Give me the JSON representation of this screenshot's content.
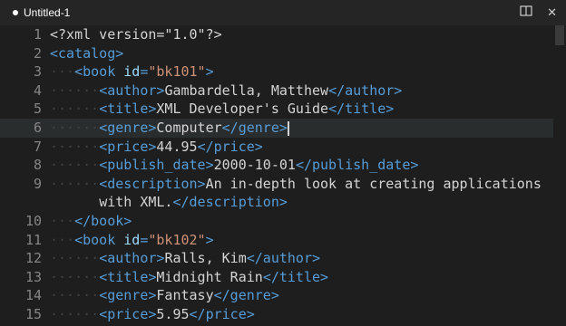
{
  "tab": {
    "title": "Untitled-1",
    "unsaved": true
  },
  "actions": {
    "split_icon": "split-editor-icon",
    "close_icon": "close-icon"
  },
  "colors": {
    "tag": "#569cd6",
    "attr": "#9cdcfe",
    "string": "#ce9178",
    "text": "#d4d4d4",
    "line_number": "#858585",
    "whitespace": "#404040"
  },
  "lines": [
    {
      "n": "1",
      "indent": "",
      "parts": [
        [
          "pi",
          "<?xml version=\"1.0\"?>"
        ]
      ]
    },
    {
      "n": "2",
      "indent": "",
      "parts": [
        [
          "tag",
          "<catalog>"
        ]
      ]
    },
    {
      "n": "3",
      "indent": "···",
      "parts": [
        [
          "tag",
          "<book "
        ],
        [
          "attr",
          "id"
        ],
        [
          "tag",
          "="
        ],
        [
          "str",
          "\"bk101\""
        ],
        [
          "tag",
          ">"
        ]
      ]
    },
    {
      "n": "4",
      "indent": "······",
      "parts": [
        [
          "tag",
          "<author>"
        ],
        [
          "txt",
          "Gambardella, Matthew"
        ],
        [
          "tag",
          "</author>"
        ]
      ]
    },
    {
      "n": "5",
      "indent": "······",
      "parts": [
        [
          "tag",
          "<title>"
        ],
        [
          "txt",
          "XML Developer's Guide"
        ],
        [
          "tag",
          "</title>"
        ]
      ]
    },
    {
      "n": "6",
      "indent": "······",
      "parts": [
        [
          "tag",
          "<genre>"
        ],
        [
          "txt",
          "Computer"
        ],
        [
          "tag",
          "</genre>"
        ]
      ],
      "current": true
    },
    {
      "n": "7",
      "indent": "······",
      "parts": [
        [
          "tag",
          "<price>"
        ],
        [
          "txt",
          "44.95"
        ],
        [
          "tag",
          "</price>"
        ]
      ]
    },
    {
      "n": "8",
      "indent": "······",
      "parts": [
        [
          "tag",
          "<publish_date>"
        ],
        [
          "txt",
          "2000-10-01"
        ],
        [
          "tag",
          "</publish_date>"
        ]
      ]
    },
    {
      "n": "9",
      "indent": "······",
      "parts": [
        [
          "tag",
          "<description>"
        ],
        [
          "txt",
          "An in-depth look at creating applications"
        ]
      ]
    },
    {
      "n": "",
      "indent": "      ",
      "parts": [
        [
          "txt",
          "with XML."
        ],
        [
          "tag",
          "</description>"
        ]
      ]
    },
    {
      "n": "10",
      "indent": "···",
      "parts": [
        [
          "tag",
          "</book>"
        ]
      ]
    },
    {
      "n": "11",
      "indent": "···",
      "parts": [
        [
          "tag",
          "<book "
        ],
        [
          "attr",
          "id"
        ],
        [
          "tag",
          "="
        ],
        [
          "str",
          "\"bk102\""
        ],
        [
          "tag",
          ">"
        ]
      ]
    },
    {
      "n": "12",
      "indent": "······",
      "parts": [
        [
          "tag",
          "<author>"
        ],
        [
          "txt",
          "Ralls, Kim"
        ],
        [
          "tag",
          "</author>"
        ]
      ]
    },
    {
      "n": "13",
      "indent": "······",
      "parts": [
        [
          "tag",
          "<title>"
        ],
        [
          "txt",
          "Midnight Rain"
        ],
        [
          "tag",
          "</title>"
        ]
      ]
    },
    {
      "n": "14",
      "indent": "······",
      "parts": [
        [
          "tag",
          "<genre>"
        ],
        [
          "txt",
          "Fantasy"
        ],
        [
          "tag",
          "</genre>"
        ]
      ]
    },
    {
      "n": "15",
      "indent": "······",
      "parts": [
        [
          "tag",
          "<price>"
        ],
        [
          "txt",
          "5.95"
        ],
        [
          "tag",
          "</price>"
        ]
      ]
    }
  ]
}
